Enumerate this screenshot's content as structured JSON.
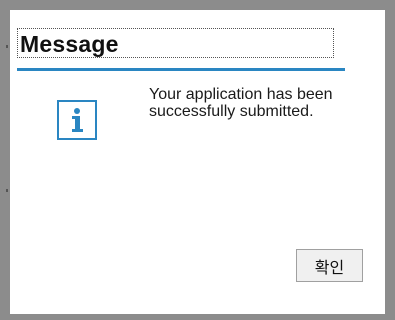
{
  "dialog": {
    "title": "Message",
    "message": "Your application has been successfully submitted.",
    "icon": "info-icon",
    "ok_label": "확인"
  },
  "colors": {
    "accent": "#2a86c2",
    "frame": "#8c8c8c",
    "button_bg": "#f0f0f0"
  }
}
